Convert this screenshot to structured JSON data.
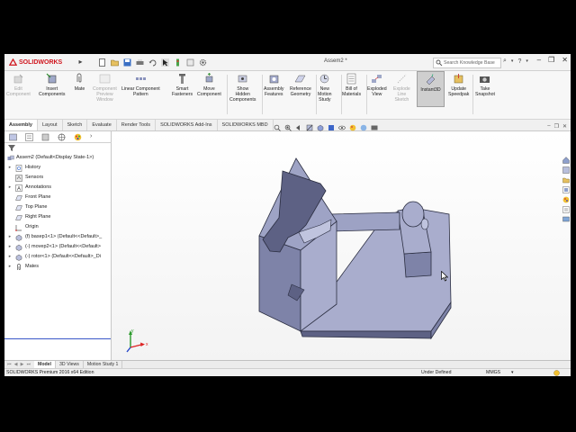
{
  "app": {
    "brand": "SOLIDWORKS",
    "document_title": "Assem2 *",
    "search_placeholder": "Search Knowledge Base"
  },
  "colors": {
    "brand_red": "#d0161e",
    "model_face": "#a9adcd",
    "model_side": "#7e83a8",
    "model_dark": "#5d6184",
    "selection_blue": "#3a57c8"
  },
  "commands": [
    {
      "label": "Edit\nComponent",
      "enabled": false
    },
    {
      "label": "Insert\nComponents",
      "enabled": true
    },
    {
      "label": "Mate",
      "enabled": true
    },
    {
      "label": "Component\nPreview\nWindow",
      "enabled": false
    },
    {
      "label": "Linear Component\nPattern",
      "enabled": true
    },
    {
      "label": "Smart\nFasteners",
      "enabled": true
    },
    {
      "label": "Move\nComponent",
      "enabled": true
    },
    {
      "label": "Show\nHidden\nComponents",
      "enabled": true
    },
    {
      "label": "Assembly\nFeatures",
      "enabled": true
    },
    {
      "label": "Reference\nGeometry",
      "enabled": true
    },
    {
      "label": "New\nMotion\nStudy",
      "enabled": true
    },
    {
      "label": "Bill of\nMaterials",
      "enabled": true
    },
    {
      "label": "Exploded\nView",
      "enabled": true
    },
    {
      "label": "Explode\nLine\nSketch",
      "enabled": false
    },
    {
      "label": "Instant3D",
      "enabled": true,
      "active": true
    },
    {
      "label": "Update\nSpeedpak",
      "enabled": true
    },
    {
      "label": "Take\nSnapshot",
      "enabled": true
    }
  ],
  "tabs": [
    "Assembly",
    "Layout",
    "Sketch",
    "Evaluate",
    "Render Tools",
    "SOLIDWORKS Add-Ins",
    "SOLIDWORKS MBD"
  ],
  "active_tab": "Assembly",
  "tree": {
    "root": "Assem2  (Default<Display State-1>)",
    "items": [
      {
        "label": "History",
        "icon": "history-icon"
      },
      {
        "label": "Sensors",
        "icon": "sensors-icon"
      },
      {
        "label": "Annotations",
        "icon": "annotations-icon"
      },
      {
        "label": "Front Plane",
        "icon": "plane-icon"
      },
      {
        "label": "Top Plane",
        "icon": "plane-icon"
      },
      {
        "label": "Right Plane",
        "icon": "plane-icon"
      },
      {
        "label": "Origin",
        "icon": "origin-icon"
      },
      {
        "label": "(f) basep1<1> (Default<<Default>_",
        "icon": "part-icon"
      },
      {
        "label": "(-) movep2<1> (Default<<Default>",
        "icon": "part-icon"
      },
      {
        "label": "(-) rotor<1> (Default<<Default>_Di",
        "icon": "part-icon"
      },
      {
        "label": "Mates",
        "icon": "mates-icon"
      }
    ]
  },
  "bottom_tabs": [
    "Model",
    "3D Views",
    "Motion Study 1"
  ],
  "active_bottom_tab": "Model",
  "status": {
    "edition": "SOLIDWORKS Premium 2016 x64 Edition",
    "state": "Under Defined",
    "units": "MMGS"
  }
}
